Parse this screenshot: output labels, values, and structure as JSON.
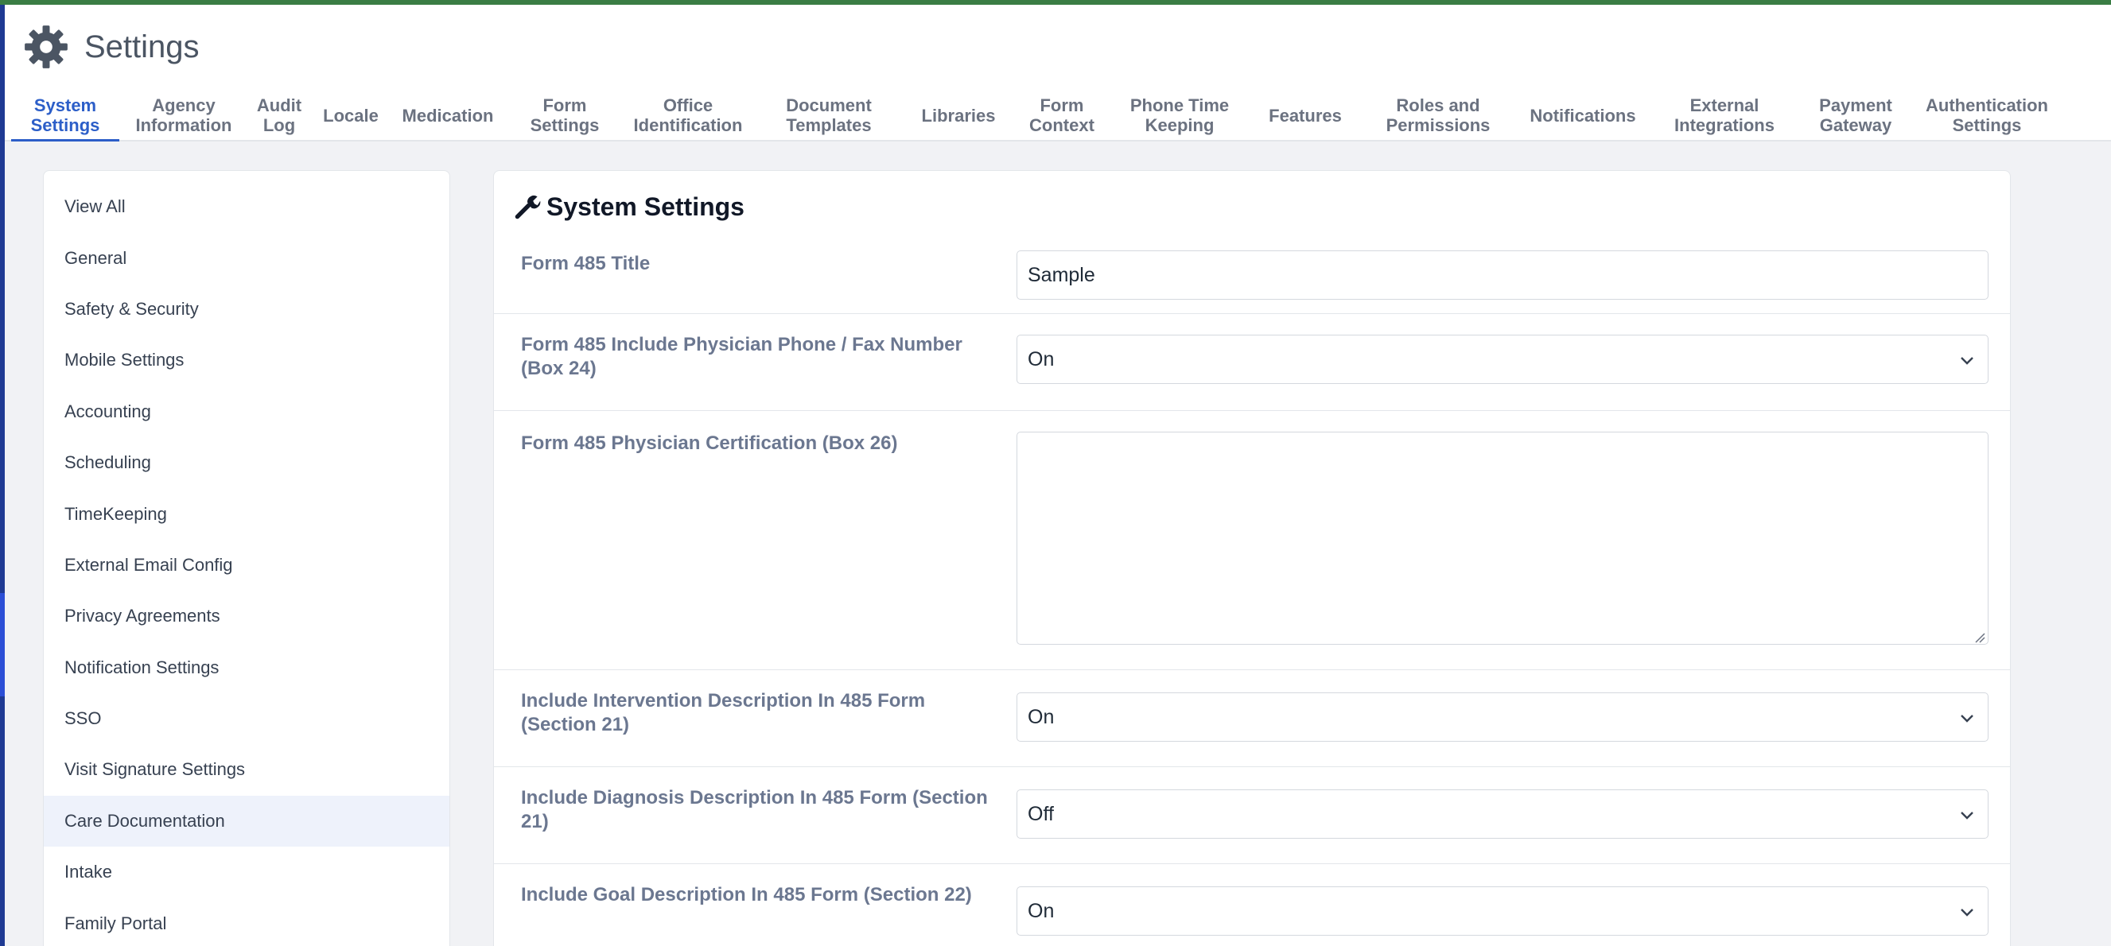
{
  "header": {
    "title": "Settings",
    "tabs": [
      {
        "label": "System\nSettings",
        "active": true
      },
      {
        "label": "Agency\nInformation"
      },
      {
        "label": "Audit\nLog"
      },
      {
        "label": "Locale"
      },
      {
        "label": "Medication"
      },
      {
        "label": "Form\nSettings"
      },
      {
        "label": "Office\nIdentification"
      },
      {
        "label": "Document\nTemplates"
      },
      {
        "label": "Libraries"
      },
      {
        "label": "Form\nContext"
      },
      {
        "label": "Phone Time\nKeeping"
      },
      {
        "label": "Features"
      },
      {
        "label": "Roles and\nPermissions"
      },
      {
        "label": "Notifications"
      },
      {
        "label": "External\nIntegrations"
      },
      {
        "label": "Payment\nGateway"
      },
      {
        "label": "Authentication\nSettings"
      }
    ]
  },
  "sidebar": {
    "items": [
      {
        "label": "View All"
      },
      {
        "label": "General"
      },
      {
        "label": "Safety & Security"
      },
      {
        "label": "Mobile Settings"
      },
      {
        "label": "Accounting"
      },
      {
        "label": "Scheduling"
      },
      {
        "label": "TimeKeeping"
      },
      {
        "label": "External Email Config"
      },
      {
        "label": "Privacy Agreements"
      },
      {
        "label": "Notification Settings"
      },
      {
        "label": "SSO"
      },
      {
        "label": "Visit Signature Settings"
      },
      {
        "label": "Care Documentation",
        "active": true
      },
      {
        "label": "Intake"
      },
      {
        "label": "Family Portal"
      }
    ]
  },
  "main": {
    "title": "System Settings",
    "rows": [
      {
        "label": "Form 485 Title",
        "value": "Sample"
      },
      {
        "label": "Form 485 Include Physician Phone / Fax Number (Box 24)",
        "value": "On"
      },
      {
        "label": "Form 485 Physician Certification (Box 26)",
        "value": ""
      },
      {
        "label": "Include Intervention Description In 485 Form (Section 21)",
        "value": "On"
      },
      {
        "label": "Include Diagnosis Description In 485 Form (Section 21)",
        "value": "Off"
      },
      {
        "label": "Include Goal Description In 485 Form (Section 22)",
        "value": "On"
      }
    ]
  },
  "icons": {
    "title": "gear-icon",
    "section": "wrench-icon",
    "dropdown": "chevron-down-icon"
  },
  "colors": {
    "accent": "#2c5ec8",
    "top_bar": "#3a7d44",
    "label": "#6b7790"
  }
}
